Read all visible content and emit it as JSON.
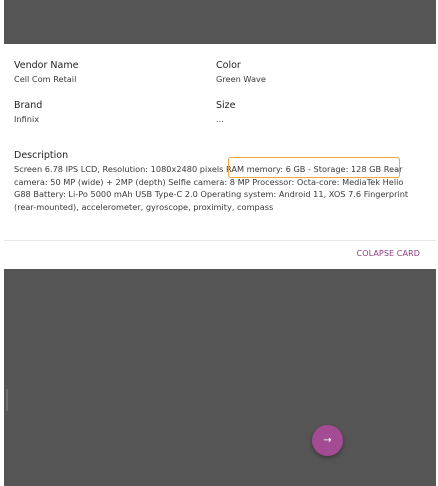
{
  "card": {
    "vendor_label": "Vendor Name",
    "vendor_value": "Cell Com Retail",
    "color_label": "Color",
    "color_value": "Green Wave",
    "brand_label": "Brand",
    "brand_value": "Infinix",
    "size_label": "Size",
    "size_value": "...",
    "description_label": "Description",
    "description_value": "Screen 6.78 IPS LCD, Resolution: 1080x2480 pixels RAM memory: 6 GB - Storage: 128 GB Rear camera: 50 MP (wide) + 2MP (depth) Selfie camera: 8 MP Processor: Octa-core: MediaTek Helio G88 Battery: Li-Po 5000 mAh USB Type-C 2.0 Operating system: Android 11, XOS 7.6 Fingerprint (rear-mounted), accelerometer, gyroscope, proximity, compass",
    "collapse_label": "COLAPSE CARD"
  },
  "fab": {
    "icon": "arrow-right-icon",
    "glyph": "→"
  },
  "colors": {
    "background": "#555555",
    "card": "#ffffff",
    "accent": "#a34c93",
    "highlight_border": "#f0a93a"
  }
}
